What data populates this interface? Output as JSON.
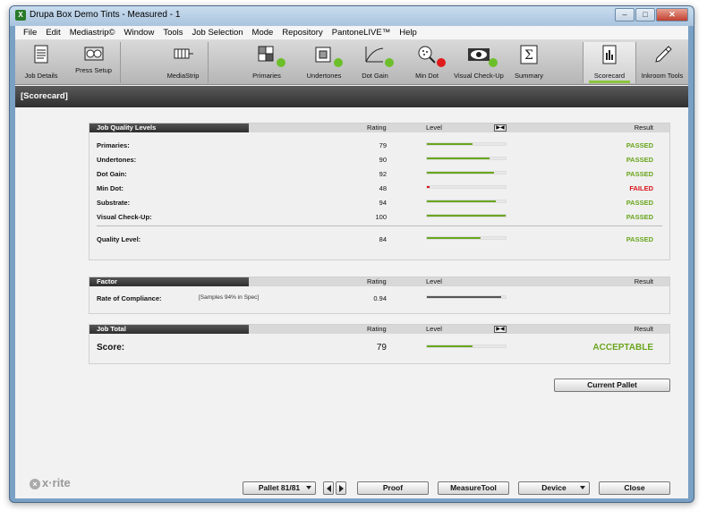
{
  "window": {
    "title": "Drupa Box Demo Tints - Measured - 1",
    "app_icon": "xrite-app-icon"
  },
  "menu": [
    "File",
    "Edit",
    "Mediastrip©",
    "Window",
    "Tools",
    "Job Selection",
    "Mode",
    "Repository",
    "PantoneLIVE™",
    "Help"
  ],
  "toolbar": {
    "job_details": "Job Details",
    "press_setup": "Press Setup",
    "mediastrip": "MediaStrip",
    "primaries": "Primaries",
    "undertones": "Undertones",
    "dot_gain": "Dot Gain",
    "min_dot": "Min Dot",
    "visual_checkup": "Visual Check-Up",
    "summary": "Summary",
    "scorecard": "Scorecard",
    "inkroom_tools": "Inkroom Tools",
    "status_ok_color": "#6cbf2a",
    "status_bad_color": "#e11b1b"
  },
  "section_title": "[Scorecard]",
  "quality": {
    "header": "Job Quality Levels",
    "col_rating": "Rating",
    "col_level": "Level",
    "col_result": "Result",
    "rows": [
      {
        "name": "Primaries:",
        "rating": "79",
        "level": 0.58,
        "result": "PASSED",
        "status": "pass"
      },
      {
        "name": "Undertones:",
        "rating": "90",
        "level": 0.8,
        "result": "PASSED",
        "status": "pass"
      },
      {
        "name": "Dot Gain:",
        "rating": "92",
        "level": 0.85,
        "result": "PASSED",
        "status": "pass"
      },
      {
        "name": "Min Dot:",
        "rating": "48",
        "level": 0.03,
        "result": "FAILED",
        "status": "fail"
      },
      {
        "name": "Substrate:",
        "rating": "94",
        "level": 0.88,
        "result": "PASSED",
        "status": "pass"
      },
      {
        "name": "Visual Check-Up:",
        "rating": "100",
        "level": 1.0,
        "result": "PASSED",
        "status": "pass"
      }
    ],
    "summary": {
      "name": "Quality Level:",
      "rating": "84",
      "level": 0.68,
      "result": "PASSED",
      "status": "pass"
    }
  },
  "factor": {
    "header": "Factor",
    "col_rating": "Rating",
    "col_level": "Level",
    "col_result": "Result",
    "row": {
      "name": "Rate of Compliance:",
      "note": "[Samples 94% in Spec]",
      "rating": "0.94",
      "level": 0.94
    }
  },
  "total": {
    "header": "Job Total",
    "col_rating": "Rating",
    "col_level": "Level",
    "col_result": "Result",
    "row": {
      "name": "Score:",
      "rating": "79",
      "level": 0.58,
      "result": "ACCEPTABLE",
      "status": "pass"
    }
  },
  "buttons": {
    "current_pallet": "Current Pallet",
    "pallet_select": "Pallet 81/81",
    "proof": "Proof",
    "measure_tool": "MeasureTool",
    "device": "Device",
    "close": "Close"
  },
  "logo": "x·rite",
  "colors": {
    "pass": "#6aa61e",
    "fail": "#d9141b",
    "accent": "#8cc63f"
  }
}
